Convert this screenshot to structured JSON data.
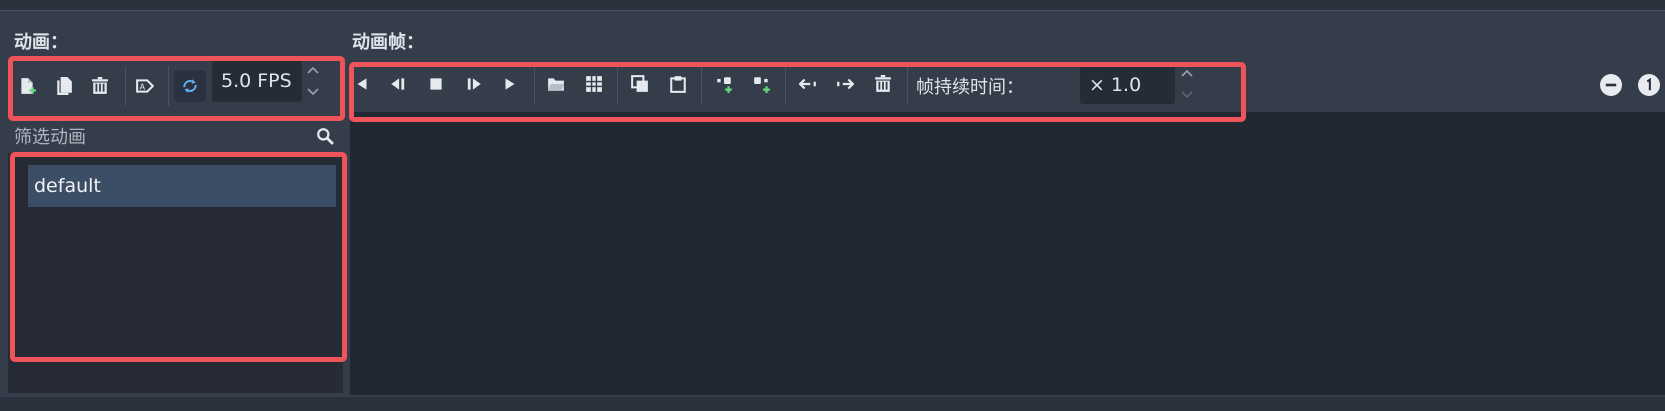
{
  "sections": {
    "animations_title": "动画：",
    "frames_title": "动画帧："
  },
  "animation_toolbar": {
    "buttons": [
      "new-animation-icon",
      "duplicate-animation-icon",
      "delete-animation-icon",
      "autoplay-icon",
      "loop-icon"
    ],
    "fps_value": "5.0 FPS"
  },
  "filter": {
    "placeholder": "筛选动画"
  },
  "animations": [
    {
      "name": "default",
      "selected": true
    }
  ],
  "frames_toolbar": {
    "duration_label": "帧持续时间：",
    "duration_value": "× 1.0"
  },
  "colors": {
    "highlight_box": "#f0545b",
    "selected_item": "#3b4e66",
    "accent_blue": "#61b0f5",
    "add_green": "#63d87d",
    "panel_bg": "#222831"
  }
}
